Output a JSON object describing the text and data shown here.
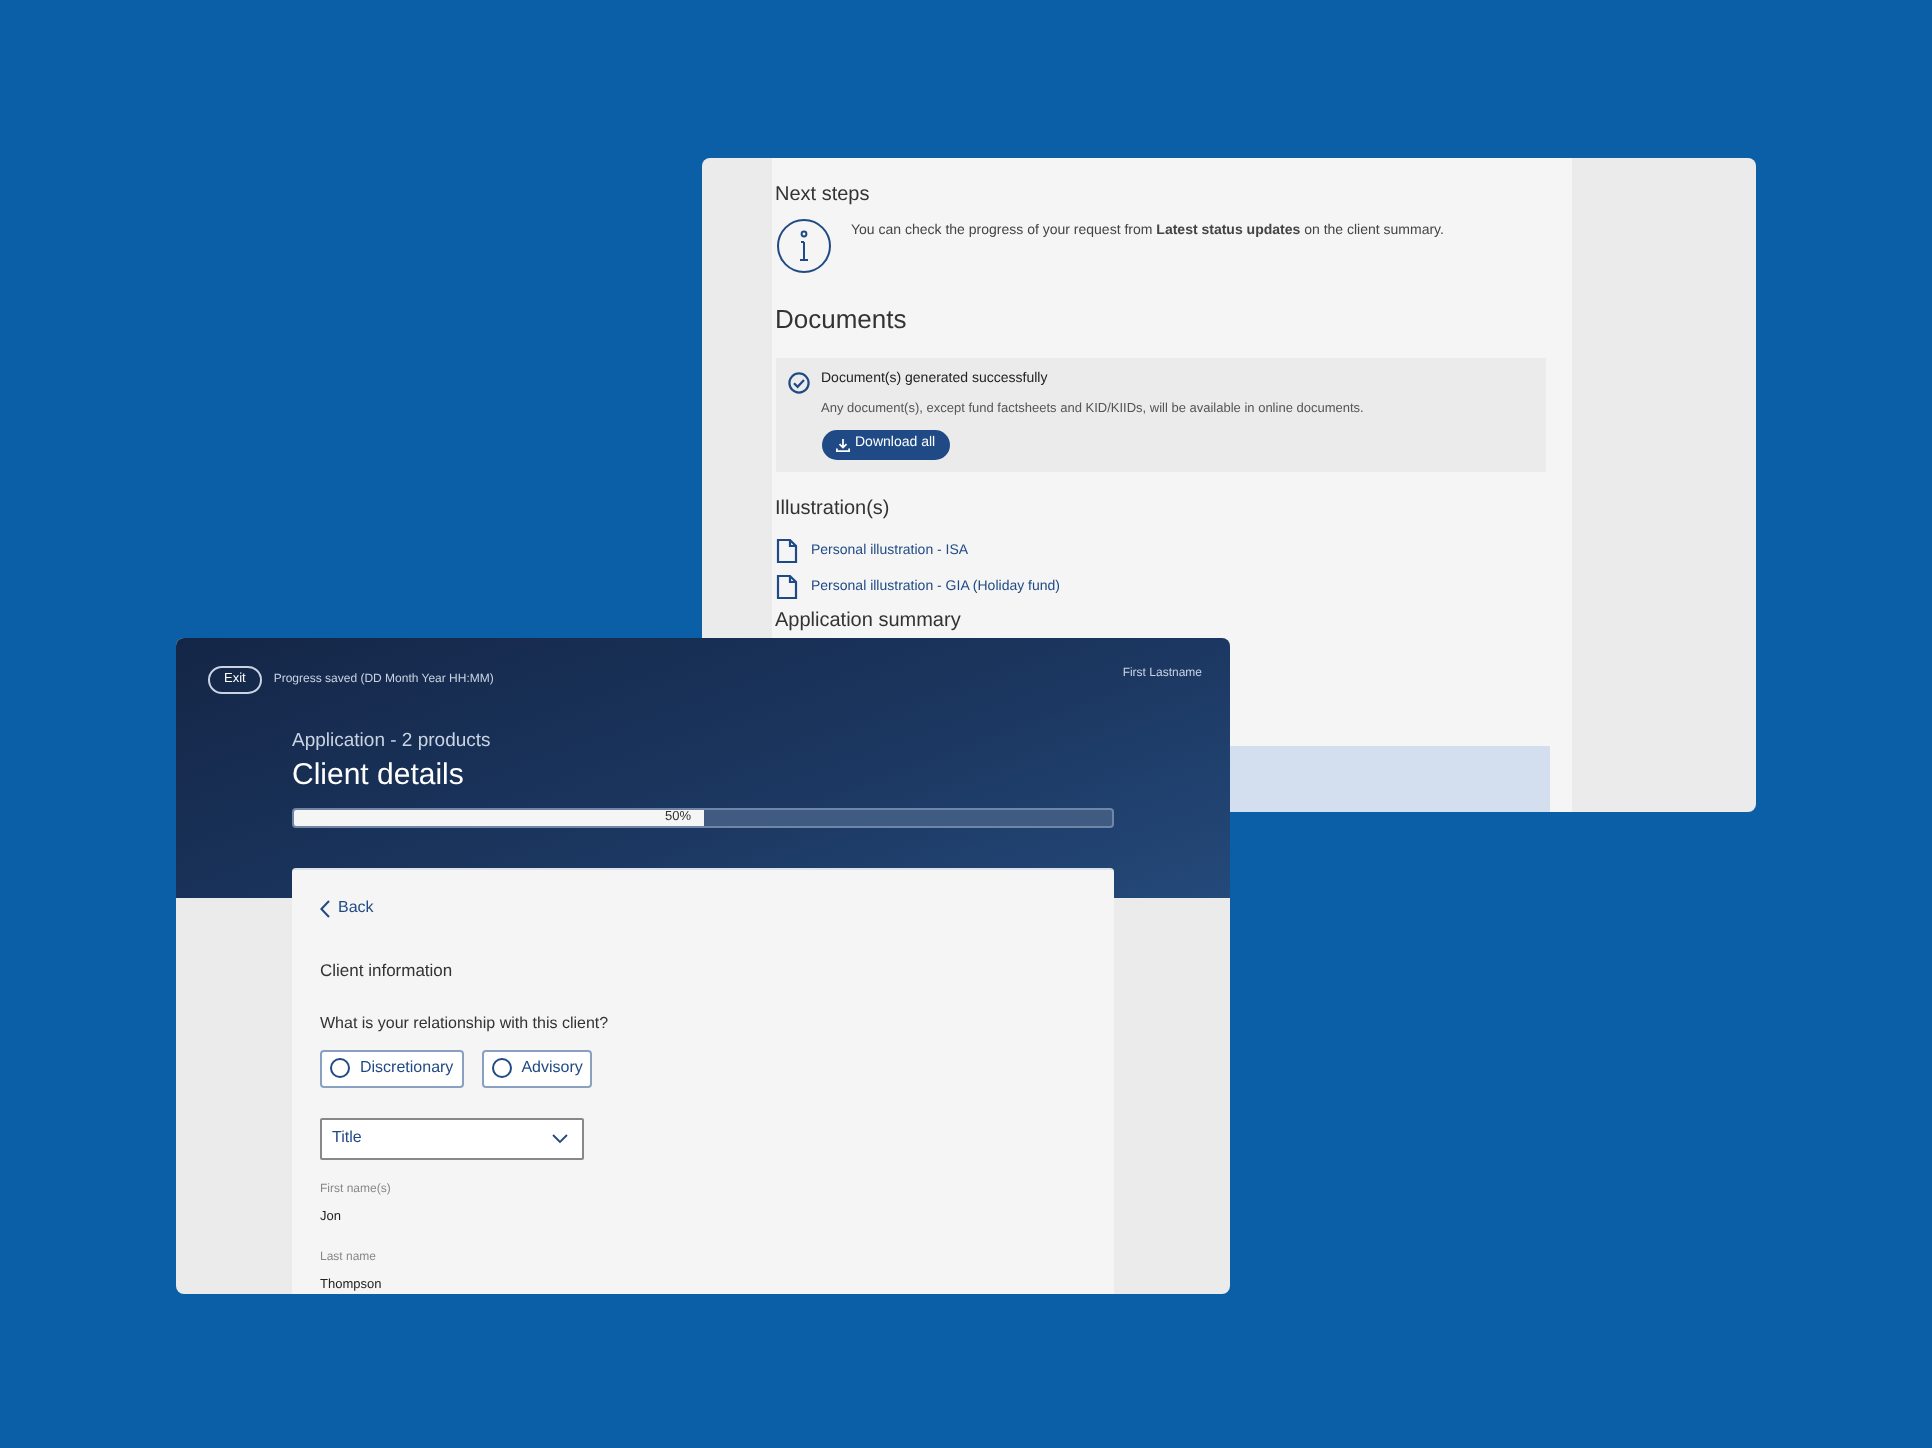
{
  "summary_window": {
    "next_steps": {
      "title": "Next steps",
      "text": "You can check the progress of your request from **Latest status updates** on the client summary."
    },
    "documents": {
      "title": "Documents",
      "status_title": "Document(s) generated successfully",
      "status_text": "Any document(s), except fund factsheets and KID/KIIDs, will be available in online documents.",
      "download_button": "Download all"
    },
    "illustrations": {
      "title": "Illustration(s)",
      "links": [
        "Personal illustration - ISA",
        "Personal illustration - GIA (Holiday fund)"
      ]
    },
    "application_summary": {
      "title": "Application summary"
    }
  },
  "application_window": {
    "exit_button": "Exit",
    "progress_saved": "Progress saved (DD Month Year HH:MM)",
    "user_name": "First Lastname",
    "subtitle": "Application - 2 products",
    "title": "Client details",
    "progress": {
      "level": 0.5,
      "reading": "50%"
    },
    "back_link": "Back",
    "section_title": "Client information",
    "question": "What is your relationship with this client?",
    "relationship_options": [
      {
        "label": "Discretionary",
        "selected": false
      },
      {
        "label": "Advisory",
        "selected": false
      }
    ],
    "title_select": {
      "placeholder": "Title"
    },
    "fields": [
      {
        "label": "First name(s)",
        "value": "Jon"
      },
      {
        "label": "Last name",
        "value": "Thompson"
      }
    ]
  }
}
